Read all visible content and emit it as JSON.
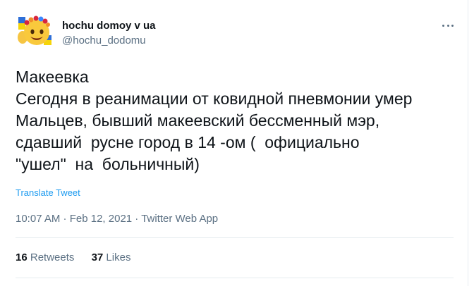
{
  "author": {
    "display_name": "hochu domoy v ua",
    "handle": "@hochu_dodomu",
    "avatar_icon": "smiley-flag-avatar-icon"
  },
  "more_icon": "more-dots-icon",
  "tweet": {
    "text": "Макеевка\nСегодня в реанимации от ковидной пневмонии умер\nМальцев, бывший макеевский бессменный мэр,\nсдавший  русне город в 14 -ом (  официально\n\"ушел\"  на  больничный)",
    "translate_label": "Translate Tweet"
  },
  "meta": {
    "time": "10:07 AM",
    "separator1": " · ",
    "date": "Feb 12, 2021",
    "separator2": " · ",
    "source": "Twitter Web App"
  },
  "stats": {
    "retweets_count": "16",
    "retweets_label": "Retweets",
    "likes_count": "37",
    "likes_label": "Likes"
  },
  "colors": {
    "text": "#0f1419",
    "secondary": "#5b7083",
    "link": "#1d9bf0",
    "divider": "#e6ecf0"
  }
}
